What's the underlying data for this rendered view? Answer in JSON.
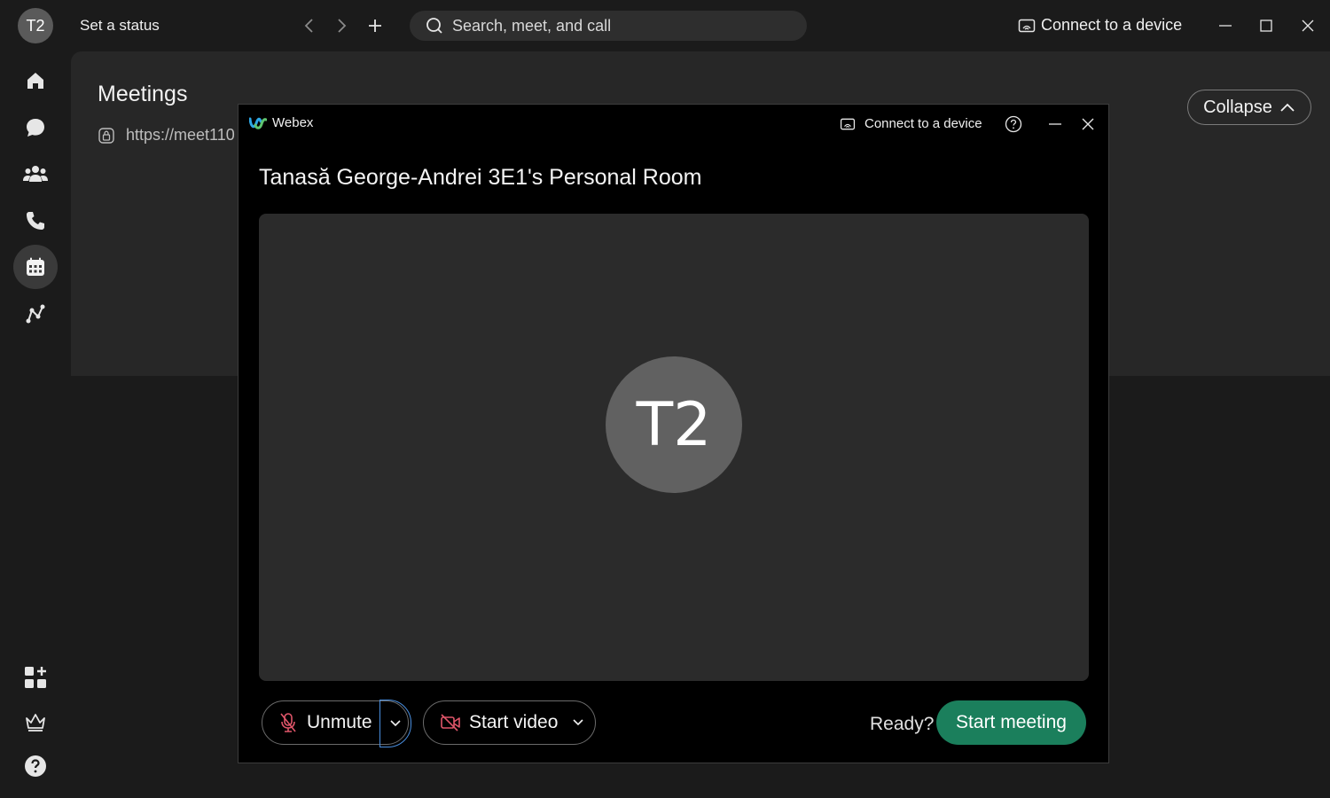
{
  "topbar": {
    "avatar_initials": "T2",
    "status_label": "Set a status",
    "search_placeholder": "Search, meet, and call",
    "connect_label": "Connect to a device"
  },
  "sidebar": {
    "items": [
      {
        "name": "home",
        "icon": "home-icon"
      },
      {
        "name": "messaging",
        "icon": "chat-icon"
      },
      {
        "name": "teams",
        "icon": "people-icon"
      },
      {
        "name": "calling",
        "icon": "phone-icon"
      },
      {
        "name": "meetings",
        "icon": "calendar-icon",
        "active": true
      },
      {
        "name": "connections",
        "icon": "graph-icon"
      }
    ],
    "bottom": [
      {
        "name": "apps",
        "icon": "apps-icon"
      },
      {
        "name": "upgrade",
        "icon": "crown-icon"
      },
      {
        "name": "help",
        "icon": "help-icon"
      }
    ]
  },
  "content": {
    "title": "Meetings",
    "link": "https://meet110",
    "collapse_label": "Collapse"
  },
  "modal": {
    "brand": "Webex",
    "connect_label": "Connect to a device",
    "room_title": "Tanasă George-Andrei 3E1's Personal Room",
    "avatar_initials": "T2",
    "unmute_label": "Unmute",
    "video_label": "Start video",
    "ready_label": "Ready?",
    "start_label": "Start meeting"
  },
  "colors": {
    "background": "#1b1b1b",
    "panel": "#272727",
    "modal": "#000000",
    "accent_green": "#1b7f5c",
    "muted_red": "#e0566a",
    "focus_blue": "#4a8fe0"
  }
}
